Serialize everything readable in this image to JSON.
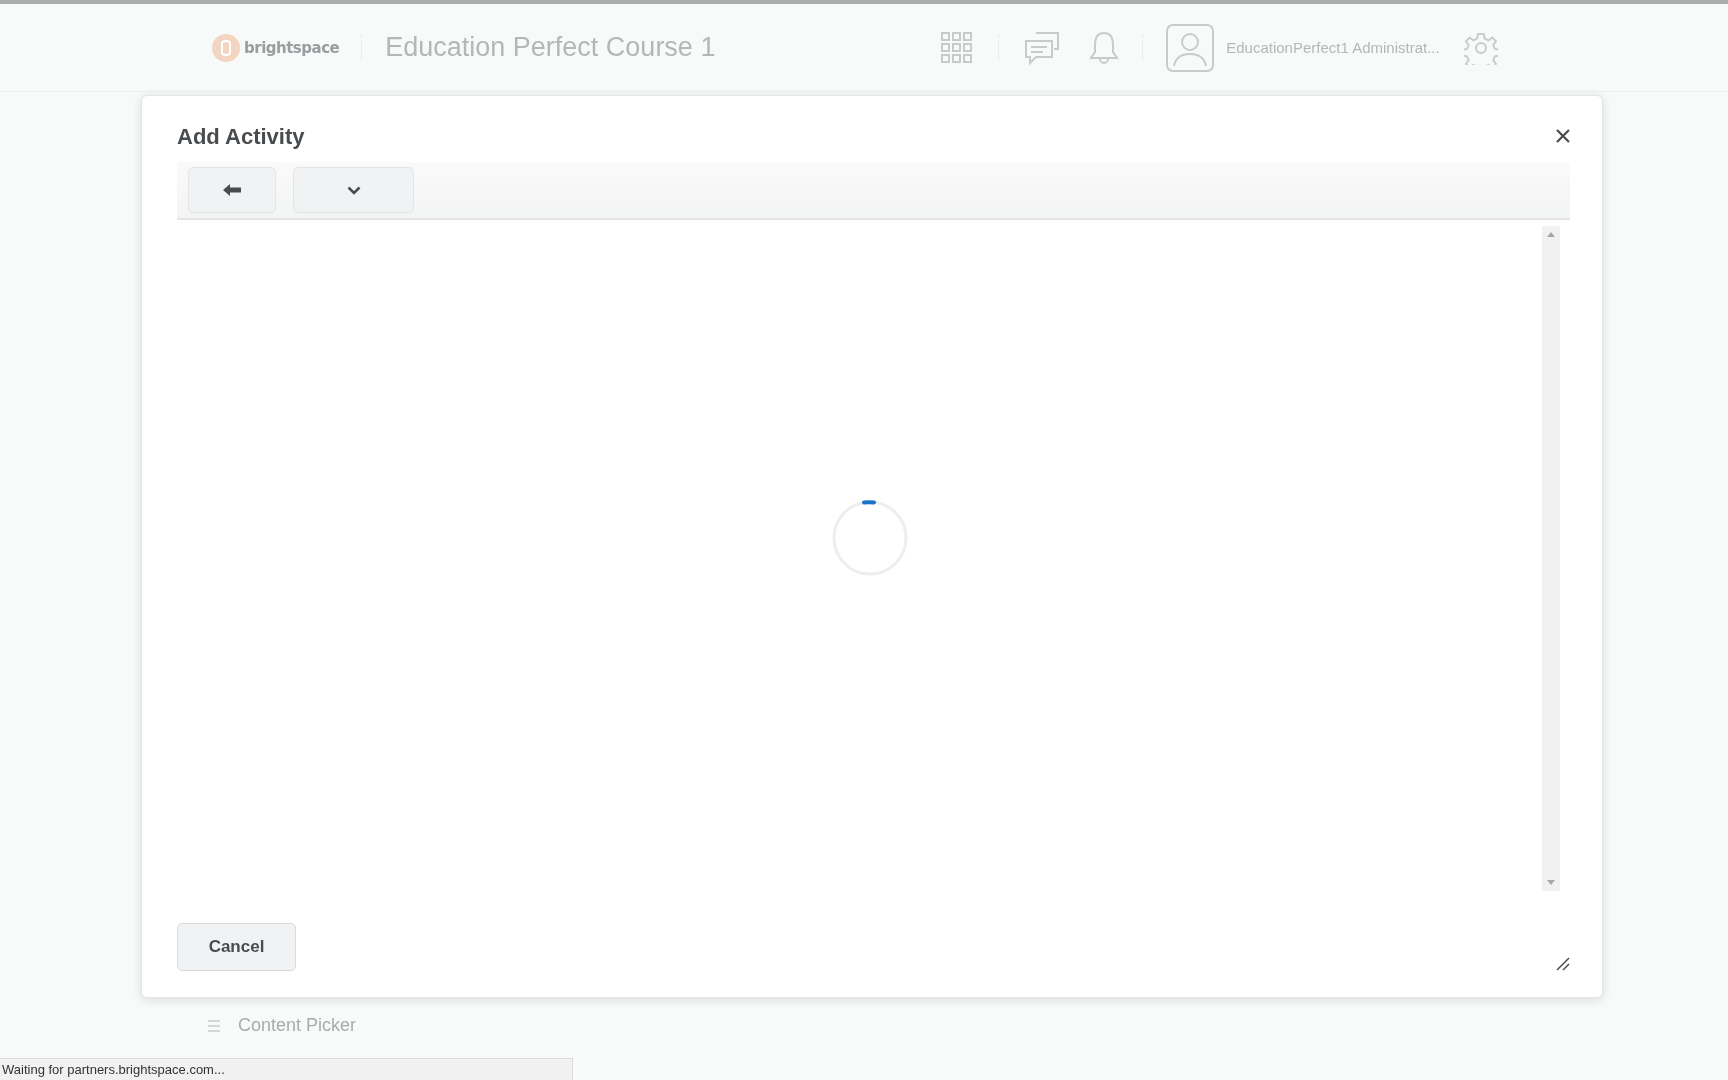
{
  "header": {
    "logo_text": "brightspace",
    "course_title": "Education Perfect Course 1",
    "user_name": "EducationPerfect1 Administrat..."
  },
  "background_page": {
    "items": [
      "Content Picker"
    ]
  },
  "dialog": {
    "title": "Add Activity",
    "loading": true,
    "buttons": [
      "Cancel"
    ]
  },
  "status_bar": {
    "text": "Waiting for partners.brightspace.com..."
  }
}
